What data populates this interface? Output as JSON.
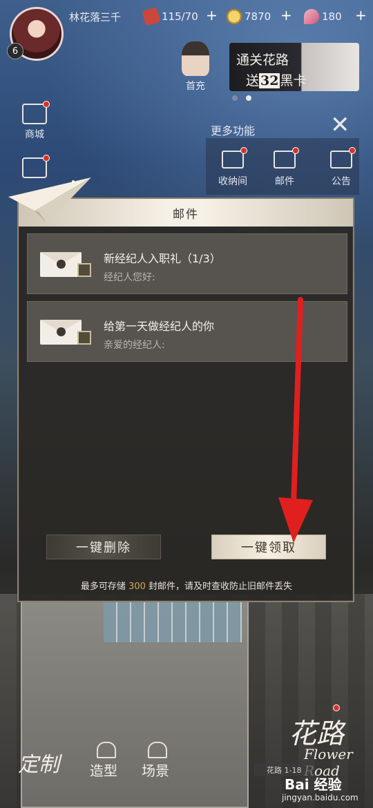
{
  "status": {
    "username": "林花落三千",
    "level": "6",
    "energy": "115/70",
    "coins": "7870",
    "gems": "180",
    "plus_label": "+"
  },
  "side": {
    "shop_label": "商城"
  },
  "top": {
    "chong_label": "首充",
    "banner_line1": "通关花路",
    "banner_line2_pre": "送",
    "banner_line2_num": "32",
    "banner_line2_post": "黑卡"
  },
  "more": {
    "title": "更多功能",
    "close": "✕",
    "items": [
      {
        "label": "收纳间"
      },
      {
        "label": "邮件"
      },
      {
        "label": "公告"
      }
    ]
  },
  "modal": {
    "title": "邮件",
    "mails": [
      {
        "title": "新经纪人入职礼（1/3）",
        "subtitle": "经纪人您好:"
      },
      {
        "title": "给第一天做经纪人的你",
        "subtitle": "亲爱的经纪人:"
      }
    ],
    "delete_all": "一键删除",
    "claim_all": "一键领取",
    "note_pre": "最多可存储",
    "note_num": "300",
    "note_post": "封邮件，请及时查收防止旧邮件丢失"
  },
  "bottom": {
    "custom": "定制",
    "style": "造型",
    "scene": "场景",
    "logo_cn": "花路",
    "logo_en": "Flower Road",
    "chapter": "花路 1-18"
  },
  "watermark": {
    "brand": "Bai 经验",
    "url": "jingyan.baidu.com"
  },
  "colors": {
    "highlight_number": "#d7a756",
    "red_dot": "#d8312b",
    "arrow": "#e01f1f"
  }
}
